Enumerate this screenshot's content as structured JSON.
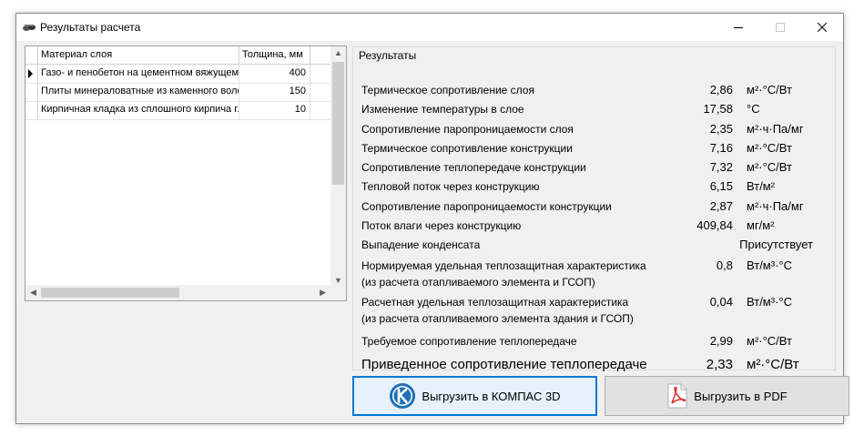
{
  "window": {
    "title": "Результаты расчета"
  },
  "grid": {
    "columns": [
      "Материал слоя",
      "Толщина, мм"
    ],
    "rows": [
      {
        "material": "Газо- и пенобетон на цементном вяжущем",
        "thickness": "400",
        "current": true
      },
      {
        "material": "Плиты минераловатные из каменного волокна",
        "thickness": "150",
        "current": false
      },
      {
        "material": "Кирпичная кладка из сплошного кирпича глиняного",
        "thickness": "10",
        "current": false
      }
    ]
  },
  "results": {
    "group_title": "Результаты",
    "items": [
      {
        "label": "Термическое сопротивление слоя",
        "value": "2,86",
        "unit": "м²·°С/Вт"
      },
      {
        "label": "Изменение температуры в слое",
        "value": "17,58",
        "unit": "°С"
      },
      {
        "label": "Сопротивление паропроницаемости слоя",
        "value": "2,35",
        "unit": "м²·ч·Па/мг"
      },
      {
        "label": "Термическое сопротивление конструкции",
        "value": "7,16",
        "unit": "м²·°С/Вт"
      },
      {
        "label": "Сопротивление теплопередаче конструкции",
        "value": "7,32",
        "unit": "м²·°С/Вт"
      },
      {
        "label": "Тепловой поток через конструкцию",
        "value": "6,15",
        "unit": "Вт/м²"
      },
      {
        "label": "Сопротивление паропроницаемости конструкции",
        "value": "2,87",
        "unit": "м²·ч·Па/мг"
      },
      {
        "label": "Поток влаги через конструкцию",
        "value": "409,84",
        "unit": "мг/м²"
      }
    ],
    "condensation": {
      "label": "Выпадение конденсата",
      "value": "Присутствует"
    },
    "normative": {
      "label1": "Нормируемая удельная теплозащитная характеристика",
      "label2": "(из расчета отапливаемого элемента и ГСОП)",
      "value": "0,8",
      "unit": "Вт/м³·°С"
    },
    "calculated": {
      "label1": "Расчетная удельная теплозащитная характеристика",
      "label2": "(из расчета отапливаемого элемента здания и ГСОП)",
      "value": "0,04",
      "unit": "Вт/м³·°С"
    },
    "required": {
      "label": "Требуемое сопротивление теплопередаче",
      "value": "2,99",
      "unit": "м²·°С/Вт"
    },
    "reduced": {
      "label": "Приведенное сопротивление теплопередаче",
      "value": "2,33",
      "unit": "м²·°С/Вт"
    }
  },
  "buttons": {
    "kompas": "Выгрузить в КОМПАС 3D",
    "pdf": "Выгрузить в PDF"
  }
}
